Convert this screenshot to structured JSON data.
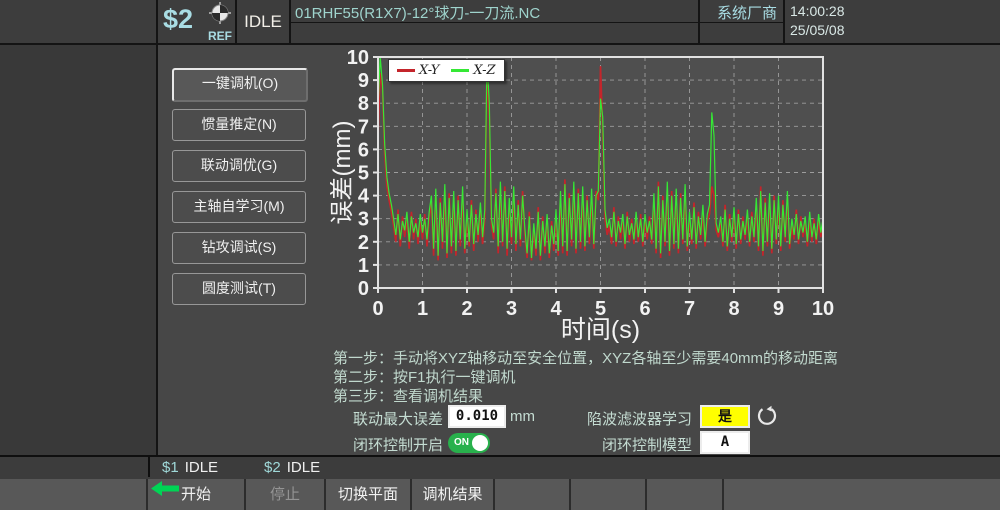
{
  "topbar": {
    "channel": "$2",
    "ref_label": "REF",
    "mode": "IDLE",
    "filename": "01RHF55(R1X7)-12°球刀-一刀流.NC",
    "vendor": "系统厂商",
    "time": "14:00:28",
    "date": "25/05/08"
  },
  "sidebar": {
    "buttons": [
      {
        "label": "一键调机(O)"
      },
      {
        "label": "惯量推定(N)"
      },
      {
        "label": "联动调优(G)"
      },
      {
        "label": "主轴自学习(M)"
      },
      {
        "label": "钻攻调试(S)"
      },
      {
        "label": "圆度测试(T)"
      }
    ]
  },
  "chart_data": {
    "type": "line",
    "xlabel": "时间(s)",
    "ylabel": "误差(mm)",
    "xlim": [
      0,
      10
    ],
    "ylim": [
      0,
      10
    ],
    "x_ticks": [
      0,
      1,
      2,
      3,
      4,
      5,
      6,
      7,
      8,
      9,
      10
    ],
    "y_ticks": [
      0,
      1,
      2,
      3,
      4,
      5,
      6,
      7,
      8,
      9,
      10
    ],
    "grid": "dashed",
    "legend_position": "top-left",
    "dx": 0.05,
    "series": [
      {
        "name": "X-Y",
        "color": "#c4252b",
        "y": [
          6.5,
          9.3,
          8.6,
          5.8,
          4.4,
          3.8,
          3.3,
          2.7,
          2.0,
          3.4,
          1.8,
          3.1,
          2.2,
          3.0,
          1.7,
          3.3,
          2.1,
          3.0,
          1.9,
          2.9,
          2.1,
          3.2,
          1.8,
          3.0,
          3.7,
          1.4,
          4.0,
          1.2,
          3.9,
          1.7,
          4.2,
          1.3,
          4.1,
          1.5,
          3.9,
          1.4,
          4.0,
          1.8,
          4.1,
          1.5,
          3.1,
          1.8,
          3.8,
          1.6,
          3.4,
          2.0,
          3.4,
          1.9,
          3.0,
          9.4,
          7.4,
          2.7,
          2.1,
          4.3,
          1.5,
          4.3,
          1.8,
          4.4,
          1.4,
          3.6,
          1.9,
          4.1,
          1.6,
          3.8,
          1.8,
          4.2,
          2.3,
          1.3,
          3.3,
          1.2,
          2.6,
          1.4,
          3.5,
          1.2,
          3.1,
          1.5,
          3.0,
          1.3,
          2.9,
          1.6,
          3.1,
          1.4,
          3.9,
          1.5,
          4.7,
          1.4,
          4.1,
          1.8,
          4.3,
          1.5,
          4.3,
          1.7,
          4.1,
          1.6,
          4.0,
          1.9,
          4.0,
          1.7,
          4.2,
          3.8,
          9.6,
          6.8,
          3.0,
          2.3,
          2.7,
          1.9,
          3.5,
          1.8,
          3.1,
          2.1,
          2.9,
          1.7,
          3.3,
          2.0,
          3.0,
          1.9,
          3.0,
          2.0,
          3.2,
          1.8,
          2.9,
          2.1,
          3.1,
          1.9,
          3.8,
          1.5,
          4.6,
          1.3,
          4.0,
          1.8,
          4.2,
          1.4,
          4.2,
          1.7,
          4.0,
          1.5,
          4.1,
          1.9,
          4.1,
          1.6,
          3.0,
          1.9,
          3.7,
          1.7,
          3.3,
          2.1,
          3.3,
          1.8,
          2.9,
          3.2,
          4.4,
          4.0,
          2.5,
          2.2,
          2.8,
          1.8,
          3.6,
          1.6,
          3.2,
          2.0,
          3.2,
          1.7,
          3.4,
          1.9,
          3.1,
          2.1,
          3.1,
          1.8,
          3.3,
          2.0,
          3.6,
          1.6,
          4.4,
          1.4,
          3.9,
          1.8,
          3.8,
          1.5,
          4.0,
          1.9,
          3.7,
          1.6,
          3.8,
          2.0,
          3.9,
          1.7,
          2.7,
          2.1,
          3.4,
          1.9,
          3.1,
          2.2,
          2.8,
          1.8,
          3.0,
          2.0,
          3.0,
          1.9,
          2.9,
          2.2,
          2.8
        ]
      },
      {
        "name": "X-Z",
        "color": "#35e835",
        "y": [
          7.8,
          10.0,
          8.8,
          6.2,
          4.8,
          4.1,
          3.6,
          3.0,
          2.3,
          3.2,
          2.1,
          2.9,
          2.5,
          3.3,
          2.0,
          3.1,
          2.4,
          2.8,
          2.2,
          3.2,
          2.4,
          3.0,
          2.1,
          3.3,
          4.0,
          1.7,
          4.3,
          1.4,
          3.7,
          2.0,
          4.5,
          1.5,
          3.9,
          1.8,
          4.2,
          1.6,
          3.8,
          2.1,
          4.4,
          1.7,
          3.4,
          2.0,
          3.6,
          1.9,
          3.2,
          2.3,
          3.7,
          2.2,
          3.4,
          9.9,
          8.0,
          3.0,
          2.4,
          4.1,
          1.8,
          4.6,
          2.0,
          4.2,
          1.7,
          3.9,
          2.2,
          4.4,
          1.9,
          3.6,
          2.1,
          4.0,
          2.6,
          1.5,
          3.1,
          1.3,
          2.8,
          1.7,
          3.3,
          1.4,
          2.9,
          1.8,
          3.2,
          1.5,
          2.7,
          1.9,
          3.4,
          1.6,
          4.2,
          1.8,
          4.5,
          1.6,
          3.9,
          2.1,
          4.6,
          1.7,
          4.1,
          2.0,
          4.4,
          1.8,
          3.8,
          2.2,
          4.3,
          1.9,
          4.0,
          4.2,
          8.2,
          7.4,
          3.4,
          2.6,
          3.0,
          2.2,
          3.3,
          2.0,
          2.9,
          2.4,
          3.2,
          1.9,
          3.1,
          2.3,
          2.8,
          2.1,
          3.3,
          2.2,
          3.0,
          2.0,
          3.2,
          2.4,
          2.9,
          2.1,
          4.1,
          1.7,
          4.4,
          1.5,
          3.8,
          2.0,
          4.6,
          1.6,
          4.0,
          1.9,
          4.3,
          1.7,
          3.9,
          2.1,
          4.5,
          1.8,
          3.3,
          2.1,
          3.5,
          1.9,
          3.1,
          2.3,
          3.6,
          2.0,
          3.2,
          3.6,
          7.6,
          6.6,
          2.8,
          2.4,
          3.1,
          2.0,
          3.4,
          1.8,
          3.0,
          2.2,
          3.5,
          1.9,
          3.2,
          2.1,
          2.9,
          2.3,
          3.4,
          2.0,
          3.1,
          2.2,
          3.9,
          1.8,
          4.2,
          1.6,
          3.7,
          2.0,
          4.1,
          1.7,
          3.8,
          2.1,
          4.0,
          1.8,
          3.6,
          2.2,
          4.2,
          1.9,
          3.0,
          2.3,
          3.2,
          2.1,
          2.9,
          2.4,
          3.1,
          2.0,
          3.3,
          2.2,
          2.8,
          2.1,
          3.2,
          2.4,
          3.0
        ]
      }
    ]
  },
  "instructions": {
    "step1": "第一步：手动将XYZ轴移动至安全位置，XYZ各轴至少需要40mm的移动距离",
    "step2": "第二步：按F1执行一键调机",
    "step3": "第三步：查看调机结果"
  },
  "fields": {
    "max_error_label": "联动最大误差",
    "max_error_value": "0.010",
    "max_error_unit": "mm",
    "notch_filter_label": "陷波滤波器学习",
    "notch_filter_value": "是",
    "closed_loop_switch_label": "闭环控制开启",
    "closed_loop_switch_state": "ON",
    "closed_loop_model_label": "闭环控制模型",
    "closed_loop_model_value": "A"
  },
  "statusbar": {
    "ch1": "$1",
    "ch1_state": "IDLE",
    "ch2": "$2",
    "ch2_state": "IDLE"
  },
  "softkeys": {
    "start": "开始",
    "stop": "停止",
    "switch_plane": "切换平面",
    "tuning_result": "调机结果"
  },
  "colors": {
    "accent_cyan": "#a9dde4",
    "series_red": "#c4252b",
    "series_green": "#35e835",
    "notch_yellow": "#ffff00",
    "toggle_green": "#28b14c",
    "arrow_green": "#00d455"
  }
}
